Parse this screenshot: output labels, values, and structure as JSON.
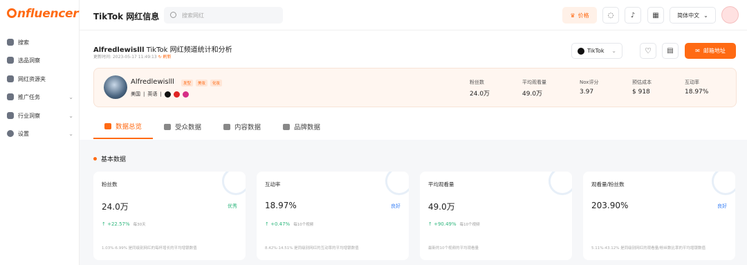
{
  "brand": {
    "logo_text": "nfluencer"
  },
  "sidebar": {
    "items": [
      {
        "label": "搜索",
        "chevron": false
      },
      {
        "label": "选品洞察",
        "chevron": false
      },
      {
        "label": "网红资源夹",
        "chevron": false
      },
      {
        "label": "推广任务",
        "chevron": true
      },
      {
        "label": "行业洞察",
        "chevron": true
      },
      {
        "label": "设置",
        "chevron": true
      }
    ]
  },
  "topbar": {
    "title": "TikTok 网红信息",
    "search_placeholder": "搜索网红",
    "price_label": "价格",
    "language": "简体中文"
  },
  "header": {
    "handle": "Alfredlewislll",
    "subtitle": "TikTok 网红频道统计和分析",
    "updated_label": "更新时间:",
    "updated_value": "2023-05-17 11:49:13",
    "refresh_label": "刷新",
    "platform": "TikTok",
    "email_button": "邮箱地址"
  },
  "profile": {
    "name": "Alfredlewislll",
    "tags": [
      "发型",
      "美妆",
      "化妆"
    ],
    "country": "美国",
    "language": "英语",
    "stats": [
      {
        "label": "粉丝数",
        "value": "24.0万"
      },
      {
        "label": "平均观看量",
        "value": "49.0万"
      },
      {
        "label": "Nox评分",
        "value": "3.97"
      },
      {
        "label": "预估成本",
        "value": "$ 918"
      },
      {
        "label": "互动率",
        "value": "18.97%"
      }
    ]
  },
  "tabs": [
    {
      "label": "数据总览",
      "active": true
    },
    {
      "label": "受众数据",
      "active": false
    },
    {
      "label": "内容数据",
      "active": false
    },
    {
      "label": "品牌数据",
      "active": false
    }
  ],
  "section_title": "基本数据",
  "cards": [
    {
      "title": "粉丝数",
      "value": "24.0万",
      "badge": "优秀",
      "badge_color": "#2eb67d",
      "growth": "↑ +22.57%",
      "growth_note": "每30天",
      "footnote": "1.03%-6.99% 是同级别网红的每杯增长的平均增银数值"
    },
    {
      "title": "互动率",
      "value": "18.97%",
      "badge": "良好",
      "badge_color": "#3b82f6",
      "growth": "↑ +0.47%",
      "growth_note": "每10个视频",
      "footnote": "8.42%-14.51% 是同级别网红的互动率的平均增银数值"
    },
    {
      "title": "平均观看量",
      "value": "49.0万",
      "badge": "",
      "badge_color": "#3b82f6",
      "growth": "↑ +90.49%",
      "growth_note": "每10个视频",
      "footnote": "最新的10个视频的平均观看量"
    },
    {
      "title": "观看量/粉丝数",
      "value": "203.90%",
      "badge": "良好",
      "badge_color": "#3b82f6",
      "growth": "",
      "growth_note": "",
      "footnote": "5.11%-43.12% 是同级别网红的观看量/粉丝数比率的平均增银数值"
    }
  ]
}
